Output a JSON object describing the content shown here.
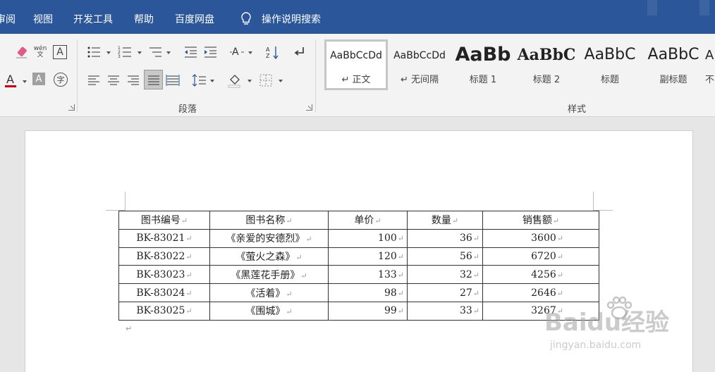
{
  "menubar": {
    "tabs": [
      "审阅",
      "视图",
      "开发工具",
      "帮助",
      "百度网盘"
    ],
    "search_label": "操作说明搜索"
  },
  "ribbon": {
    "font_group": {
      "phonetic_icon_text": "wén\n文",
      "border_char_text": "A",
      "font_color_hex": "#d40000",
      "circle_char_text": "字"
    },
    "paragraph_group": {
      "label": "段落"
    },
    "styles_group": {
      "label": "样式",
      "items": [
        {
          "preview": "AaBbCcDd",
          "name": "↵ 正文"
        },
        {
          "preview": "AaBbCcDd",
          "name": "↵ 无间隔"
        },
        {
          "preview": "AaBb",
          "name": "标题 1"
        },
        {
          "preview": "AaBbC",
          "name": "标题 2"
        },
        {
          "preview": "AaBbC",
          "name": "标题"
        },
        {
          "preview": "AaBbC",
          "name": "副标题"
        },
        {
          "preview": "A",
          "name": "不"
        }
      ]
    }
  },
  "table": {
    "headers": [
      "图书编号",
      "图书名称",
      "单价",
      "数量",
      "销售额"
    ],
    "rows": [
      [
        "BK-83021",
        "《亲爱的安德烈》",
        "100",
        "36",
        "3600"
      ],
      [
        "BK-83022",
        "《萤火之森》",
        "120",
        "56",
        "6720"
      ],
      [
        "BK-83023",
        "《黑莲花手册》",
        "133",
        "32",
        "4256"
      ],
      [
        "BK-83024",
        "《活着》",
        "98",
        "27",
        "2646"
      ],
      [
        "BK-83025",
        "《围城》",
        "99",
        "33",
        "3267"
      ]
    ],
    "cell_mark": "↵",
    "para_mark": "↵"
  },
  "watermark": {
    "main": "Baidu经验",
    "sub": "jingyan.baidu.com"
  },
  "colors": {
    "menubar": "#2b579a",
    "ribbon": "#f3f3f3",
    "workspace": "#e6e6e6"
  }
}
